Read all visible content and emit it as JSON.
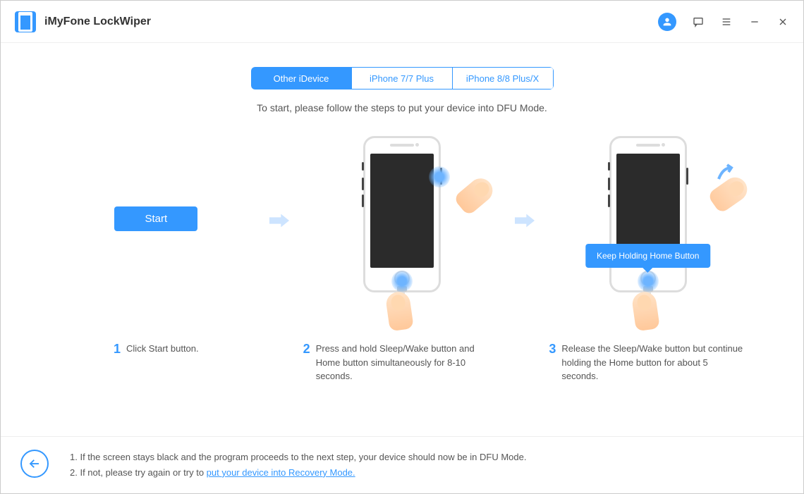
{
  "app": {
    "title": "iMyFone LockWiper"
  },
  "tabs": {
    "t0": "Other iDevice",
    "t1": "iPhone 7/7 Plus",
    "t2": "iPhone 8/8 Plus/X"
  },
  "instruction": "To start, please follow the steps to put your device into DFU Mode.",
  "start_label": "Start",
  "tooltip": "Keep Holding Home Button",
  "steps": {
    "s1": {
      "num": "1",
      "text": "Click Start button."
    },
    "s2": {
      "num": "2",
      "text": "Press and hold Sleep/Wake button and Home button simultaneously for 8-10 seconds."
    },
    "s3": {
      "num": "3",
      "text": "Release the Sleep/Wake button but continue holding the Home button for about 5 seconds."
    }
  },
  "footer": {
    "n1_pre": "1. If the screen stays black and the program proceeds to the next step, your device should now be in DFU Mode.",
    "n2_pre": "2. If not, please try again or try to ",
    "n2_link": "put your device into Recovery Mode."
  }
}
